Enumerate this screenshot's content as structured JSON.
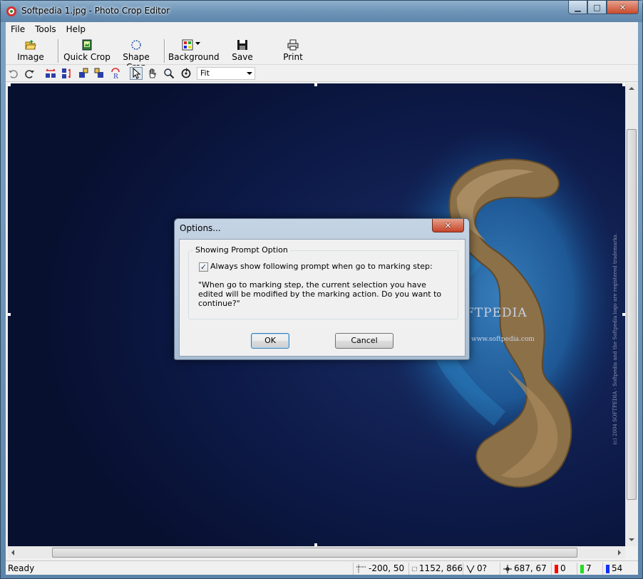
{
  "window": {
    "title": "Softpedia 1.jpg - Photo Crop Editor"
  },
  "caption_buttons": {
    "minimize": "▁",
    "maximize": "□",
    "close": "✕"
  },
  "menu": [
    "File",
    "Tools",
    "Help"
  ],
  "toolbar": {
    "image": "Image",
    "quick_crop": "Quick Crop",
    "shape_crop": "Shape Crop",
    "background": "Background",
    "save": "Save",
    "print": "Print"
  },
  "zoom": {
    "value": "Fit"
  },
  "watermark": {
    "logo": "FTPEDIA",
    "url": "www.softpedia.com",
    "copyright": "(c) 2004 SOFTPEDIA - Softpedia and the Softpedia logo are registered trademarks."
  },
  "dialog": {
    "title": "Options...",
    "close": "✕",
    "group_label": "Showing Prompt Option",
    "checkbox_checked": true,
    "checkbox_label": "Always show following prompt when go to marking step:",
    "prompt_text": "\"When go to marking step, the current selection you have edited will be modified by the marking action. Do you want to continue?\"",
    "ok": "OK",
    "cancel": "Cancel"
  },
  "status": {
    "ready": "Ready",
    "position": "-200, 50",
    "size": "1152, 866",
    "angle": "0?",
    "cursor": "687, 67",
    "red": "0",
    "green": "7",
    "blue": "54"
  },
  "colors": {
    "red": "#ff0000",
    "green": "#22dd22",
    "blue": "#1030ff",
    "canvas_bg": "#0b1438"
  }
}
